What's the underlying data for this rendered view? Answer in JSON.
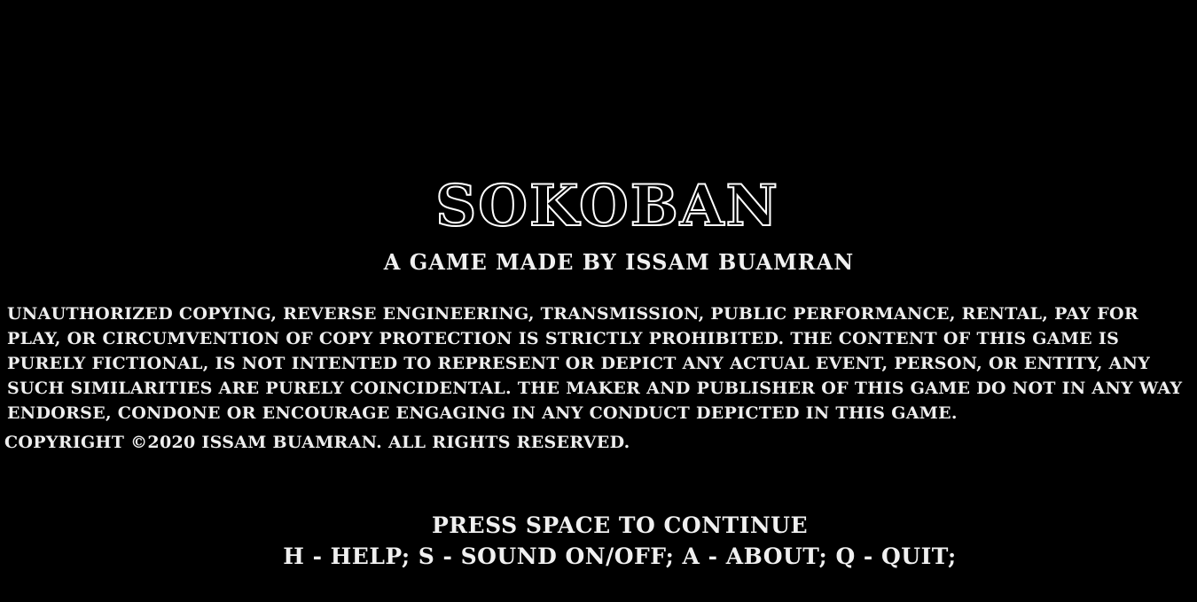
{
  "screen": {
    "background": "#000000",
    "text_color": "#ffffff"
  },
  "title": "SOKOBAN",
  "subtitle": "A GAME MADE BY ISSAM BUAMRAN",
  "legal_notice": "UNAUTHORIZED COPYING, REVERSE ENGINEERING, TRANSMISSION, PUBLIC PERFORMANCE, RENTAL, PAY FOR PLAY, OR CIRCUMVENTION OF COPY PROTECTION IS STRICTLY PROHIBITED. THE CONTENT OF THIS GAME IS PURELY FICTIONAL, IS NOT INTENTED TO REPRESENT OR DEPICT ANY ACTUAL EVENT, PERSON, OR ENTITY, ANY SUCH SIMILARITIES ARE PURELY COINCIDENTAL. THE MAKER AND PUBLISHER OF THIS GAME DO NOT IN ANY WAY ENDORSE, CONDONE OR ENCOURAGE ENGAGING IN ANY CONDUCT DEPICTED IN THIS GAME.",
  "copyright": "COPYRIGHT ©2020 ISSAM BUAMRAN. ALL RIGHTS RESERVED.",
  "prompt": "PRESS SPACE TO CONTINUE",
  "key_help": "H - HELP; S - SOUND ON/OFF; A - ABOUT; Q - QUIT;"
}
